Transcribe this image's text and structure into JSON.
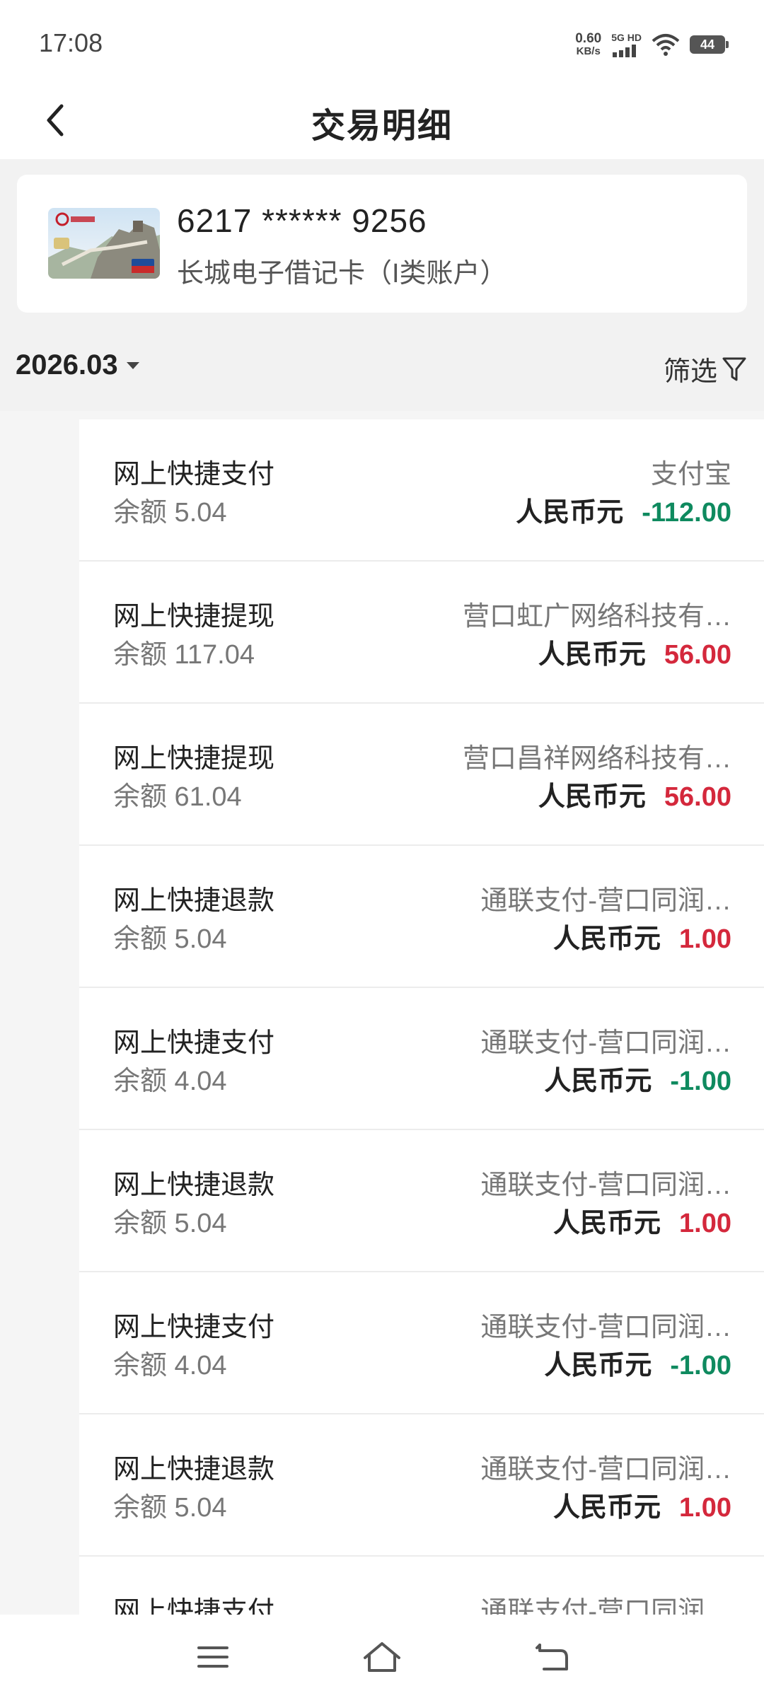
{
  "status_bar": {
    "time": "17:08",
    "net_speed_value": "0.60",
    "net_speed_unit": "KB/s",
    "network_label": "5G HD",
    "battery": "44"
  },
  "header": {
    "title": "交易明细",
    "back_icon": "chevron-left-icon"
  },
  "card": {
    "number": "6217 ****** 9256",
    "type": "长城电子借记卡（I类账户）"
  },
  "filter_bar": {
    "month": "2026.03",
    "filter_label": "筛选",
    "filter_icon": "funnel-icon"
  },
  "colors": {
    "debit": "#0f8a5f",
    "credit": "#d4283c"
  },
  "transactions": [
    {
      "title": "网上快捷支付",
      "balance": "余额 5.04",
      "merchant": "支付宝",
      "currency": "人民币元",
      "amount": "-112.00",
      "direction": "debit"
    },
    {
      "title": "网上快捷提现",
      "balance": "余额 117.04",
      "merchant": "营口虹广网络科技有…",
      "currency": "人民币元",
      "amount": "56.00",
      "direction": "credit"
    },
    {
      "title": "网上快捷提现",
      "balance": "余额 61.04",
      "merchant": "营口昌祥网络科技有…",
      "currency": "人民币元",
      "amount": "56.00",
      "direction": "credit"
    },
    {
      "title": "网上快捷退款",
      "balance": "余额 5.04",
      "merchant": "通联支付-营口同润…",
      "currency": "人民币元",
      "amount": "1.00",
      "direction": "credit"
    },
    {
      "title": "网上快捷支付",
      "balance": "余额 4.04",
      "merchant": "通联支付-营口同润…",
      "currency": "人民币元",
      "amount": "-1.00",
      "direction": "debit"
    },
    {
      "title": "网上快捷退款",
      "balance": "余额 5.04",
      "merchant": "通联支付-营口同润…",
      "currency": "人民币元",
      "amount": "1.00",
      "direction": "credit"
    },
    {
      "title": "网上快捷支付",
      "balance": "余额 4.04",
      "merchant": "通联支付-营口同润…",
      "currency": "人民币元",
      "amount": "-1.00",
      "direction": "debit"
    },
    {
      "title": "网上快捷退款",
      "balance": "余额 5.04",
      "merchant": "通联支付-营口同润…",
      "currency": "人民币元",
      "amount": "1.00",
      "direction": "credit"
    },
    {
      "title": "网上快捷支付",
      "balance": "",
      "merchant": "通联支付-营口同润…",
      "currency": "",
      "amount": "",
      "direction": "debit"
    }
  ],
  "nav_bar": {
    "menu_icon": "menu-icon",
    "home_icon": "home-icon",
    "back_icon": "back-arrow-icon"
  }
}
